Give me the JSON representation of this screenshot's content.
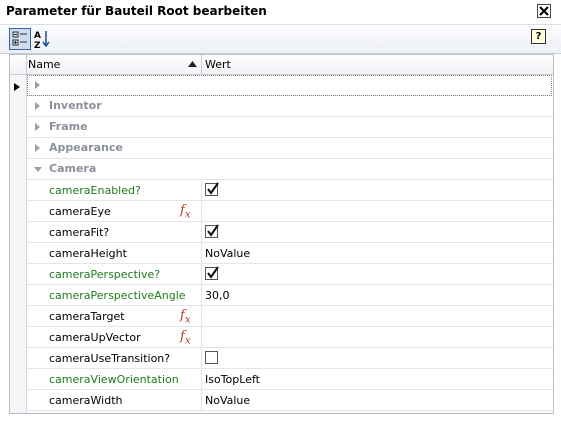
{
  "window": {
    "title": "Parameter für Bauteil Root bearbeiten"
  },
  "toolbar": {
    "categorized_icon": "categorized-icon",
    "alphabetical_icon": "sort-az-icon",
    "help_icon": "help-icon",
    "help_label": "?"
  },
  "grid": {
    "columns": {
      "name": "Name",
      "value": "Wert"
    },
    "categories": [
      {
        "label": "Inventor",
        "expanded": false
      },
      {
        "label": "Frame",
        "expanded": false
      },
      {
        "label": "Appearance",
        "expanded": false
      },
      {
        "label": "Camera",
        "expanded": true
      }
    ],
    "properties": [
      {
        "name": "cameraEnabled?",
        "color": "green",
        "checkbox": true,
        "checked": true,
        "value": "",
        "fx": false
      },
      {
        "name": "cameraEye",
        "color": "black",
        "checkbox": false,
        "value": "",
        "fx": true
      },
      {
        "name": "cameraFit?",
        "color": "black",
        "checkbox": true,
        "checked": true,
        "value": "",
        "fx": false
      },
      {
        "name": "cameraHeight",
        "color": "black",
        "checkbox": false,
        "value": "NoValue",
        "fx": false
      },
      {
        "name": "cameraPerspective?",
        "color": "green",
        "checkbox": true,
        "checked": true,
        "value": "",
        "fx": false
      },
      {
        "name": "cameraPerspectiveAngle",
        "color": "green",
        "checkbox": false,
        "value": "30,0",
        "fx": false
      },
      {
        "name": "cameraTarget",
        "color": "black",
        "checkbox": false,
        "value": "",
        "fx": true
      },
      {
        "name": "cameraUpVector",
        "color": "black",
        "checkbox": false,
        "value": "",
        "fx": true
      },
      {
        "name": "cameraUseTransition?",
        "color": "black",
        "checkbox": true,
        "checked": false,
        "value": "",
        "fx": false
      },
      {
        "name": "cameraViewOrientation",
        "color": "green",
        "checkbox": false,
        "value": "IsoTopLeft",
        "fx": false
      },
      {
        "name": "cameraWidth",
        "color": "black",
        "checkbox": false,
        "value": "NoValue",
        "fx": false
      }
    ],
    "fx_symbol": "fx"
  },
  "colors": {
    "green_text": "#1e7a1e",
    "category_text": "#8a8f99",
    "fx_red": "#c0392b",
    "selection_border": "#3c64a4"
  }
}
